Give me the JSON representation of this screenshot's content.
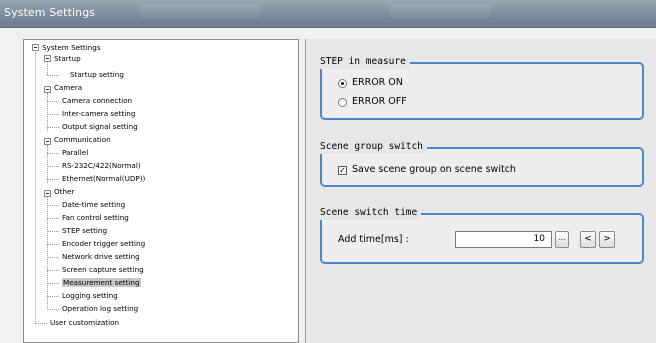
{
  "window": {
    "title": "System Settings"
  },
  "tree": {
    "root": "System Settings",
    "startup": "Startup",
    "startup_setting": "Startup setting",
    "camera": "Camera",
    "camera_connection": "Camera connection",
    "inter_camera": "Inter-camera setting",
    "output_signal": "Output signal setting",
    "communication": "Communication",
    "parallel": "Parallel",
    "rs232": "RS-232C/422(Normal)",
    "ethernet": "Ethernet(Normal(UDP))",
    "other": "Other",
    "datetime": "Date-time setting",
    "fan": "Fan control setting",
    "step": "STEP setting",
    "encoder": "Encoder trigger setting",
    "network": "Network drive setting",
    "screen_capture": "Screen capture setting",
    "measurement": "Measurement setting",
    "logging": "Logging setting",
    "operation_log": "Operation log setting",
    "user_custom": "User customization"
  },
  "step_group": {
    "title": "STEP in measure",
    "error_on": "ERROR ON",
    "error_off": "ERROR OFF",
    "selected": "ERROR ON"
  },
  "scene_group": {
    "title": "Scene group switch",
    "save_label": "Save scene group on scene switch",
    "checked": true
  },
  "scene_time": {
    "title": "Scene switch time",
    "label": "Add time[ms] :",
    "value": "10",
    "dots": "...",
    "prev": "<",
    "next": ">"
  },
  "colors": {
    "accent": "#4a86c8",
    "titlebar": "#7f8d9c",
    "selection": "#c8c8c8"
  }
}
